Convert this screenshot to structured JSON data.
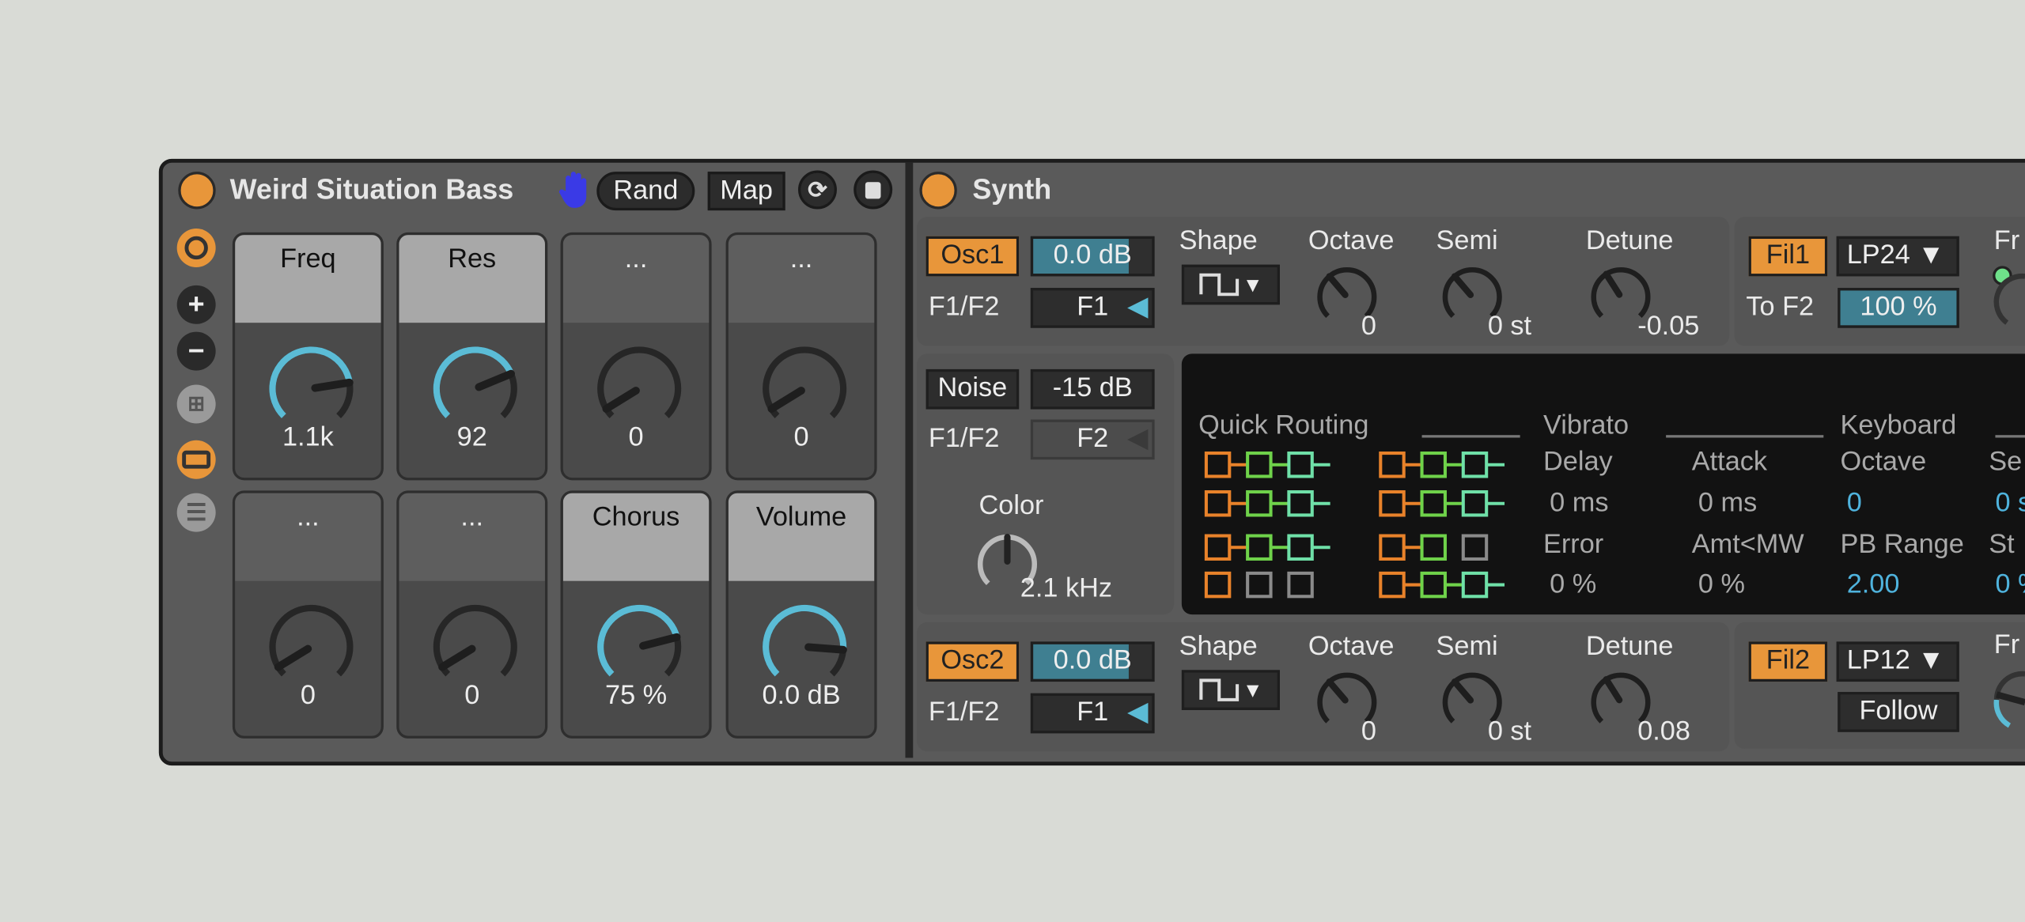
{
  "colors": {
    "accent": "#e8963a",
    "knob_active": "#5bbcd6",
    "hand": "#3a3ae6"
  },
  "rack": {
    "title": "Weird Situation Bass",
    "rand_label": "Rand",
    "map_label": "Map",
    "macros": [
      {
        "name": "Freq",
        "value": "1.1k",
        "mapped": true,
        "fraction": 0.8
      },
      {
        "name": "Res",
        "value": "92",
        "mapped": true,
        "fraction": 0.75
      },
      {
        "name": "...",
        "value": "0",
        "mapped": false,
        "fraction": 0.05
      },
      {
        "name": "...",
        "value": "0",
        "mapped": false,
        "fraction": 0.05
      },
      {
        "name": "...",
        "value": "0",
        "mapped": false,
        "fraction": 0.05
      },
      {
        "name": "...",
        "value": "0",
        "mapped": false,
        "fraction": 0.05
      },
      {
        "name": "Chorus",
        "value": "75 %",
        "mapped": true,
        "fraction": 0.78
      },
      {
        "name": "Volume",
        "value": "0.0 dB",
        "mapped": true,
        "fraction": 0.85
      }
    ]
  },
  "synth": {
    "title": "Synth",
    "osc1": {
      "label": "Osc1",
      "level": "0.0 dB",
      "level_fraction": 0.8,
      "f1f2_label": "F1/F2",
      "f1f2": "F1",
      "shape_label": "Shape",
      "octave_label": "Octave",
      "octave": "0",
      "semi_label": "Semi",
      "semi": "0 st",
      "detune_label": "Detune",
      "detune": "-0.05"
    },
    "osc2": {
      "label": "Osc2",
      "level": "0.0 dB",
      "level_fraction": 0.8,
      "f1f2_label": "F1/F2",
      "f1f2": "F1",
      "shape_label": "Shape",
      "octave_label": "Octave",
      "octave": "0",
      "semi_label": "Semi",
      "semi": "0 st",
      "detune_label": "Detune",
      "detune": "0.08"
    },
    "fil1": {
      "label": "Fil1",
      "type": "LP24",
      "to_f2_label": "To F2",
      "to_f2": "100 %",
      "to_f2_fraction": 1.0,
      "freq_label": "Fr"
    },
    "fil2": {
      "label": "Fil2",
      "type": "LP12",
      "follow_label": "Follow",
      "freq_label": "Fr"
    },
    "noise": {
      "label": "Noise",
      "level": "-15 dB",
      "f1f2_label": "F1/F2",
      "f1f2": "F2",
      "color_label": "Color",
      "color": "2.1 kHz"
    },
    "display": {
      "quick_routing": "Quick Routing",
      "vibrato": "Vibrato",
      "delay_label": "Delay",
      "delay": "0 ms",
      "attack_label": "Attack",
      "attack": "0 ms",
      "error_label": "Error",
      "error": "0 %",
      "amt_label": "Amt<MW",
      "amt": "0 %",
      "keyboard": "Keyboard",
      "kb_octave_label": "Octave",
      "kb_octave": "0",
      "pb_label": "PB Range",
      "pb": "2.00",
      "semi_label": "Se",
      "semi": "0 s",
      "stretch_label": "St",
      "stretch": "0 %"
    }
  }
}
